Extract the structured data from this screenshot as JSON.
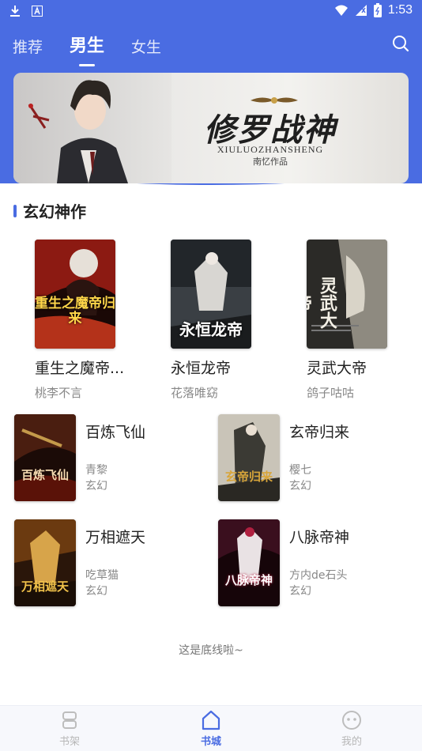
{
  "status_bar": {
    "time": "1:53"
  },
  "top_nav": {
    "tabs": [
      {
        "label": "推荐",
        "active": false
      },
      {
        "label": "男生",
        "active": true
      },
      {
        "label": "女生",
        "active": false
      }
    ],
    "search_icon": "search-icon"
  },
  "banner": {
    "title": "修罗战神",
    "pinyin": "XIULUOZHANSHENG",
    "author": "南忆作品"
  },
  "section": {
    "title": "玄幻神作",
    "featured": [
      {
        "title": "重生之魔帝...",
        "author": "桃李不言",
        "cover_text": "重生之魔帝归来",
        "cover_color": "#8c1a12"
      },
      {
        "title": "永恒龙帝",
        "author": "花落唯窈",
        "cover_text": "永恒龙帝",
        "cover_color": "#3a3f44"
      },
      {
        "title": "灵武大帝",
        "author": "鸽子咕咕",
        "cover_text": "灵武大帝",
        "cover_color": "#2b2a27"
      }
    ],
    "list": [
      {
        "title": "百炼飞仙",
        "author": "青黎",
        "genre": "玄幻",
        "cover_text": "百炼飞仙",
        "cover_color": "#4a1e10"
      },
      {
        "title": "玄帝归来",
        "author": "樱七",
        "genre": "玄幻",
        "cover_text": "玄帝归来",
        "cover_color": "#3b3a34"
      },
      {
        "title": "万相遮天",
        "author": "吃草猫",
        "genre": "玄幻",
        "cover_text": "万相遮天",
        "cover_color": "#6b3a10"
      },
      {
        "title": "八脉帝神",
        "author": "方内de石头",
        "genre": "玄幻",
        "cover_text": "八脉帝神",
        "cover_color": "#3a0f1e"
      }
    ]
  },
  "footer_note": "这是底线啦~",
  "bottom_nav": {
    "items": [
      {
        "label": "书架",
        "icon": "bookshelf-icon",
        "active": false
      },
      {
        "label": "书城",
        "icon": "home-icon",
        "active": true
      },
      {
        "label": "我的",
        "icon": "profile-icon",
        "active": false
      }
    ]
  },
  "colors": {
    "primary": "#4a6ce2",
    "inactive": "#b7b7b7"
  }
}
